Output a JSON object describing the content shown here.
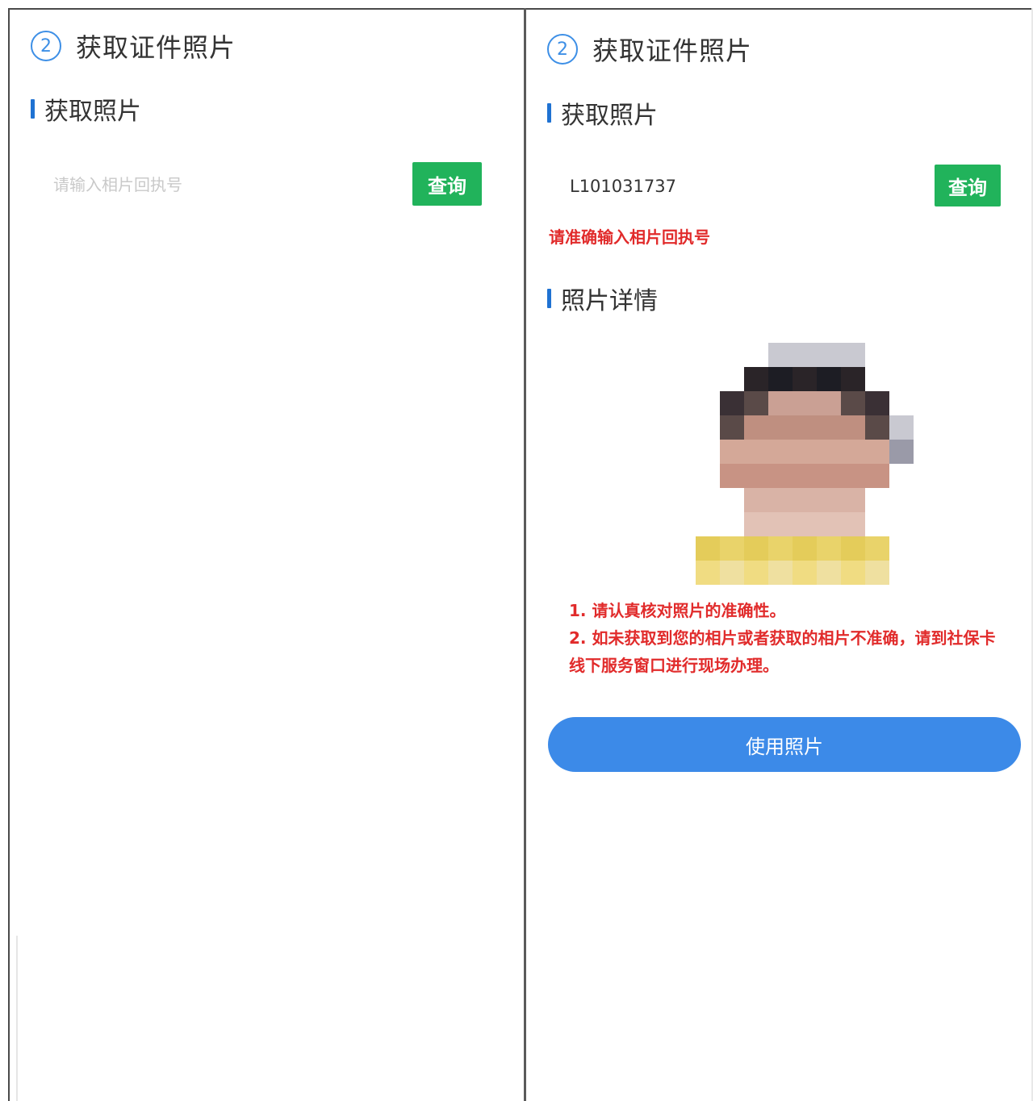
{
  "left_panel": {
    "step_number": "2",
    "step_title": "获取证件照片",
    "section_title": "获取照片",
    "receipt_input": {
      "value": "",
      "placeholder": "请输入相片回执号"
    },
    "query_button": "查询"
  },
  "right_panel": {
    "step_number": "2",
    "step_title": "获取证件照片",
    "section_title": "获取照片",
    "receipt_input": {
      "value": "L101031737",
      "placeholder": "请输入相片回执号"
    },
    "query_button": "查询",
    "error_message": "请准确输入相片回执号",
    "details_title": "照片详情",
    "notes": [
      "1. 请认真核对照片的准确性。",
      "2. 如未获取到您的相片或者获取的相片不准确，请到社保卡线下服务窗口进行现场办理。"
    ],
    "use_photo_button": "使用照片"
  },
  "colors": {
    "accent_blue": "#3c8ae8",
    "section_bar": "#1f72d2",
    "query_green": "#21b35b",
    "error_red": "#e12b2b"
  }
}
